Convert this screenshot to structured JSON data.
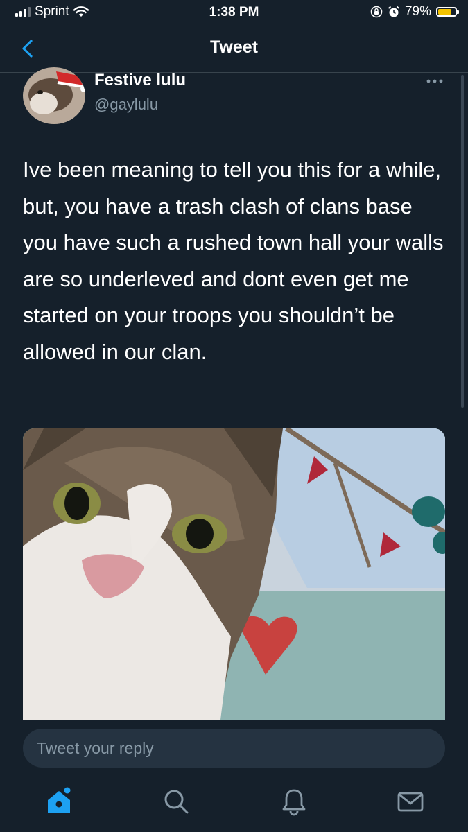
{
  "status_bar": {
    "carrier": "Sprint",
    "time": "1:38 PM",
    "battery_percent": "79%",
    "battery_level": 0.79
  },
  "header": {
    "title": "Tweet"
  },
  "tweet": {
    "display_name": "Festive lulu",
    "handle": "@gaylulu",
    "text": "Ive been meaning to tell you this for a while, but, you have a trash clash of clans base you have such a rushed town hall your walls are so underleved and dont even get me started on your troops you shouldn’t be allowed in our clan."
  },
  "reply": {
    "placeholder": "Tweet your reply"
  },
  "tabs": [
    {
      "icon": "home-icon",
      "active": true
    },
    {
      "icon": "search-icon",
      "active": false
    },
    {
      "icon": "bell-icon",
      "active": false
    },
    {
      "icon": "mail-icon",
      "active": false
    }
  ],
  "colors": {
    "background": "#15202b",
    "accent": "#1da1f2",
    "muted": "#8899a6",
    "battery": "#f5c400"
  }
}
